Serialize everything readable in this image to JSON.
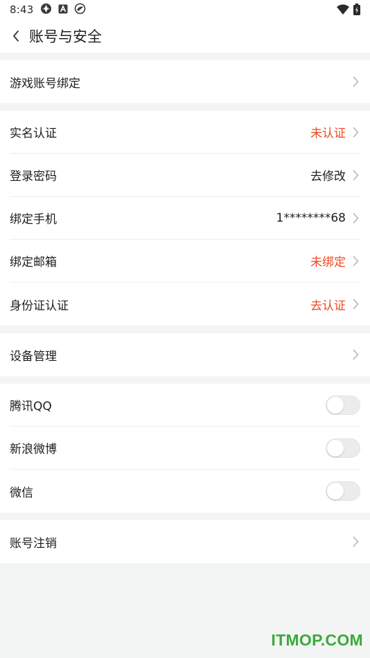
{
  "status_bar": {
    "time": "8:43",
    "left_icons": [
      "network-status-icon",
      "app-notification-icon",
      "bird-notification-icon"
    ],
    "right_icons": [
      "wifi-icon",
      "battery-icon"
    ]
  },
  "header": {
    "title": "账号与安全",
    "back_icon": "chevron-left-icon"
  },
  "groups": [
    {
      "rows": [
        {
          "label": "游戏账号绑定",
          "value": "",
          "value_type": "normal",
          "control": "chevron"
        }
      ]
    },
    {
      "rows": [
        {
          "label": "实名认证",
          "value": "未认证",
          "value_type": "alert",
          "control": "chevron"
        },
        {
          "label": "登录密码",
          "value": "去修改",
          "value_type": "normal",
          "control": "chevron"
        },
        {
          "label": "绑定手机",
          "value": "1********68",
          "value_type": "normal",
          "control": "chevron"
        },
        {
          "label": "绑定邮箱",
          "value": "未绑定",
          "value_type": "alert",
          "control": "chevron"
        },
        {
          "label": "身份证认证",
          "value": "去认证",
          "value_type": "alert",
          "control": "chevron"
        }
      ]
    },
    {
      "rows": [
        {
          "label": "设备管理",
          "value": "",
          "value_type": "normal",
          "control": "chevron"
        }
      ]
    },
    {
      "rows": [
        {
          "label": "腾讯QQ",
          "control": "toggle",
          "on": false
        },
        {
          "label": "新浪微博",
          "control": "toggle",
          "on": false
        },
        {
          "label": "微信",
          "control": "toggle",
          "on": false
        }
      ]
    },
    {
      "rows": [
        {
          "label": "账号注销",
          "value": "",
          "value_type": "normal",
          "control": "chevron"
        }
      ]
    }
  ],
  "colors": {
    "alert": "#f0481f",
    "background": "#f3f5f5",
    "watermark": "#3aaa3a"
  },
  "watermark": "ITMOP.COM"
}
